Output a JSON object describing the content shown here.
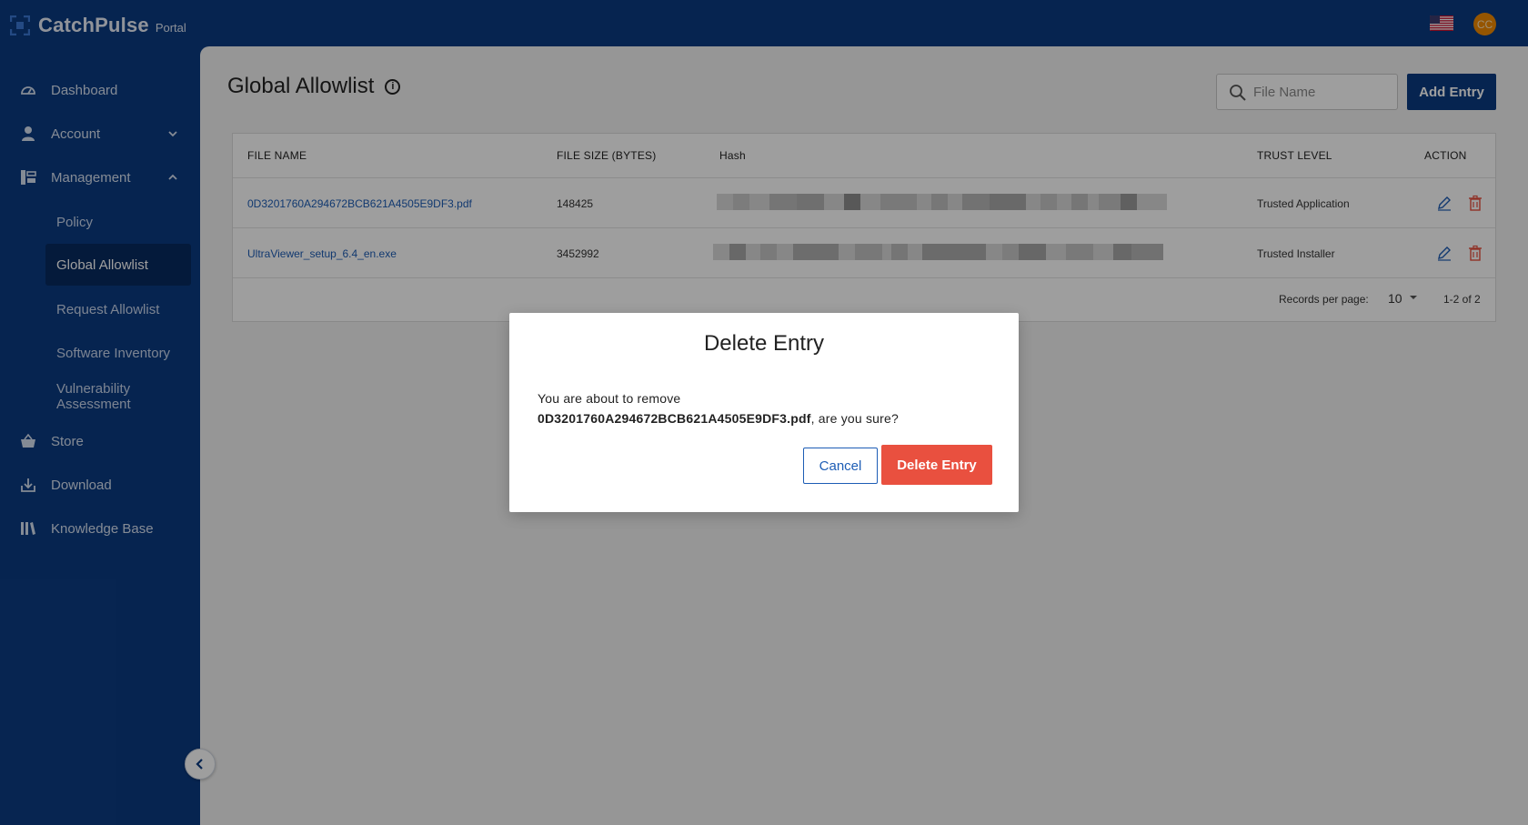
{
  "app": {
    "name": "CatchPulse",
    "subtitle": "Portal",
    "avatar_initials": "CC",
    "brand_color": "#0b3b82",
    "danger_color": "#e9503f"
  },
  "sidebar": {
    "items": [
      {
        "label": "Dashboard",
        "icon": "gauge-icon"
      },
      {
        "label": "Account",
        "icon": "user-icon",
        "expanded": false
      },
      {
        "label": "Management",
        "icon": "management-icon",
        "expanded": true
      },
      {
        "label": "Store",
        "icon": "basket-icon"
      },
      {
        "label": "Download",
        "icon": "download-icon"
      },
      {
        "label": "Knowledge Base",
        "icon": "books-icon"
      }
    ],
    "management_children": [
      {
        "label": "Policy",
        "active": false
      },
      {
        "label": "Global Allowlist",
        "active": true
      },
      {
        "label": "Request Allowlist",
        "active": false
      },
      {
        "label": "Software Inventory",
        "active": false
      },
      {
        "label": "Vulnerability Assessment",
        "active": false
      }
    ]
  },
  "page": {
    "title": "Global Allowlist",
    "search_placeholder": "File Name",
    "add_button": "Add Entry"
  },
  "table": {
    "columns": [
      "FILE NAME",
      "FILE SIZE (BYTES)",
      "Hash",
      "TRUST LEVEL",
      "ACTION"
    ],
    "rows": [
      {
        "file_name": "0D3201760A294672BCB621A4505E9DF3.pdf",
        "file_size": "148425",
        "trust_level": "Trusted Application"
      },
      {
        "file_name": "UltraViewer_setup_6.4_en.exe",
        "file_size": "3452992",
        "trust_level": "Trusted Installer"
      }
    ],
    "footer": {
      "records_label": "Records per page:",
      "records_value": "10",
      "range": "1-2 of 2"
    }
  },
  "dialog": {
    "title": "Delete Entry",
    "message_prefix": "You are about to remove",
    "target": "0D3201760A294672BCB621A4505E9DF3.pdf",
    "message_suffix": ", are you sure?",
    "cancel_label": "Cancel",
    "confirm_label": "Delete Entry"
  }
}
